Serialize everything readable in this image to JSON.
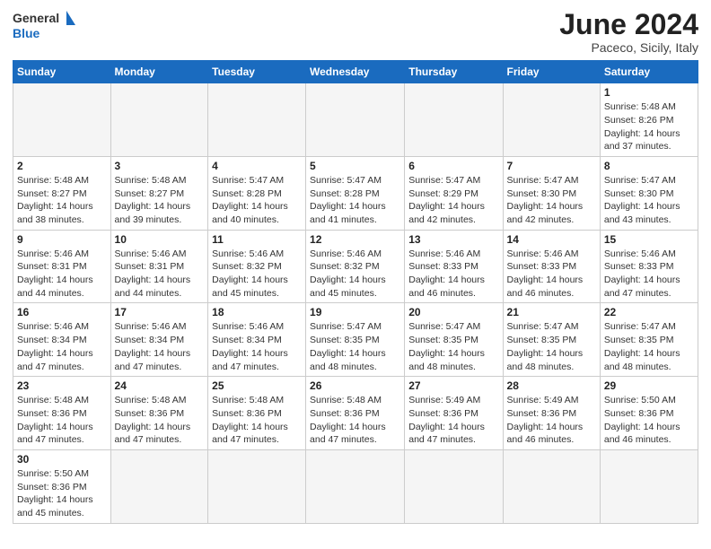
{
  "header": {
    "logo_general": "General",
    "logo_blue": "Blue",
    "title": "June 2024",
    "subtitle": "Paceco, Sicily, Italy"
  },
  "columns": [
    "Sunday",
    "Monday",
    "Tuesday",
    "Wednesday",
    "Thursday",
    "Friday",
    "Saturday"
  ],
  "weeks": [
    [
      {
        "day": "",
        "info": ""
      },
      {
        "day": "",
        "info": ""
      },
      {
        "day": "",
        "info": ""
      },
      {
        "day": "",
        "info": ""
      },
      {
        "day": "",
        "info": ""
      },
      {
        "day": "",
        "info": ""
      },
      {
        "day": "1",
        "info": "Sunrise: 5:48 AM\nSunset: 8:26 PM\nDaylight: 14 hours\nand 37 minutes."
      }
    ],
    [
      {
        "day": "2",
        "info": "Sunrise: 5:48 AM\nSunset: 8:27 PM\nDaylight: 14 hours\nand 38 minutes."
      },
      {
        "day": "3",
        "info": "Sunrise: 5:48 AM\nSunset: 8:27 PM\nDaylight: 14 hours\nand 39 minutes."
      },
      {
        "day": "4",
        "info": "Sunrise: 5:47 AM\nSunset: 8:28 PM\nDaylight: 14 hours\nand 40 minutes."
      },
      {
        "day": "5",
        "info": "Sunrise: 5:47 AM\nSunset: 8:28 PM\nDaylight: 14 hours\nand 41 minutes."
      },
      {
        "day": "6",
        "info": "Sunrise: 5:47 AM\nSunset: 8:29 PM\nDaylight: 14 hours\nand 42 minutes."
      },
      {
        "day": "7",
        "info": "Sunrise: 5:47 AM\nSunset: 8:30 PM\nDaylight: 14 hours\nand 42 minutes."
      },
      {
        "day": "8",
        "info": "Sunrise: 5:47 AM\nSunset: 8:30 PM\nDaylight: 14 hours\nand 43 minutes."
      }
    ],
    [
      {
        "day": "9",
        "info": "Sunrise: 5:46 AM\nSunset: 8:31 PM\nDaylight: 14 hours\nand 44 minutes."
      },
      {
        "day": "10",
        "info": "Sunrise: 5:46 AM\nSunset: 8:31 PM\nDaylight: 14 hours\nand 44 minutes."
      },
      {
        "day": "11",
        "info": "Sunrise: 5:46 AM\nSunset: 8:32 PM\nDaylight: 14 hours\nand 45 minutes."
      },
      {
        "day": "12",
        "info": "Sunrise: 5:46 AM\nSunset: 8:32 PM\nDaylight: 14 hours\nand 45 minutes."
      },
      {
        "day": "13",
        "info": "Sunrise: 5:46 AM\nSunset: 8:33 PM\nDaylight: 14 hours\nand 46 minutes."
      },
      {
        "day": "14",
        "info": "Sunrise: 5:46 AM\nSunset: 8:33 PM\nDaylight: 14 hours\nand 46 minutes."
      },
      {
        "day": "15",
        "info": "Sunrise: 5:46 AM\nSunset: 8:33 PM\nDaylight: 14 hours\nand 47 minutes."
      }
    ],
    [
      {
        "day": "16",
        "info": "Sunrise: 5:46 AM\nSunset: 8:34 PM\nDaylight: 14 hours\nand 47 minutes."
      },
      {
        "day": "17",
        "info": "Sunrise: 5:46 AM\nSunset: 8:34 PM\nDaylight: 14 hours\nand 47 minutes."
      },
      {
        "day": "18",
        "info": "Sunrise: 5:46 AM\nSunset: 8:34 PM\nDaylight: 14 hours\nand 47 minutes."
      },
      {
        "day": "19",
        "info": "Sunrise: 5:47 AM\nSunset: 8:35 PM\nDaylight: 14 hours\nand 48 minutes."
      },
      {
        "day": "20",
        "info": "Sunrise: 5:47 AM\nSunset: 8:35 PM\nDaylight: 14 hours\nand 48 minutes."
      },
      {
        "day": "21",
        "info": "Sunrise: 5:47 AM\nSunset: 8:35 PM\nDaylight: 14 hours\nand 48 minutes."
      },
      {
        "day": "22",
        "info": "Sunrise: 5:47 AM\nSunset: 8:35 PM\nDaylight: 14 hours\nand 48 minutes."
      }
    ],
    [
      {
        "day": "23",
        "info": "Sunrise: 5:48 AM\nSunset: 8:36 PM\nDaylight: 14 hours\nand 47 minutes."
      },
      {
        "day": "24",
        "info": "Sunrise: 5:48 AM\nSunset: 8:36 PM\nDaylight: 14 hours\nand 47 minutes."
      },
      {
        "day": "25",
        "info": "Sunrise: 5:48 AM\nSunset: 8:36 PM\nDaylight: 14 hours\nand 47 minutes."
      },
      {
        "day": "26",
        "info": "Sunrise: 5:48 AM\nSunset: 8:36 PM\nDaylight: 14 hours\nand 47 minutes."
      },
      {
        "day": "27",
        "info": "Sunrise: 5:49 AM\nSunset: 8:36 PM\nDaylight: 14 hours\nand 47 minutes."
      },
      {
        "day": "28",
        "info": "Sunrise: 5:49 AM\nSunset: 8:36 PM\nDaylight: 14 hours\nand 46 minutes."
      },
      {
        "day": "29",
        "info": "Sunrise: 5:50 AM\nSunset: 8:36 PM\nDaylight: 14 hours\nand 46 minutes."
      }
    ],
    [
      {
        "day": "30",
        "info": "Sunrise: 5:50 AM\nSunset: 8:36 PM\nDaylight: 14 hours\nand 45 minutes."
      },
      {
        "day": "",
        "info": ""
      },
      {
        "day": "",
        "info": ""
      },
      {
        "day": "",
        "info": ""
      },
      {
        "day": "",
        "info": ""
      },
      {
        "day": "",
        "info": ""
      },
      {
        "day": "",
        "info": ""
      }
    ]
  ]
}
